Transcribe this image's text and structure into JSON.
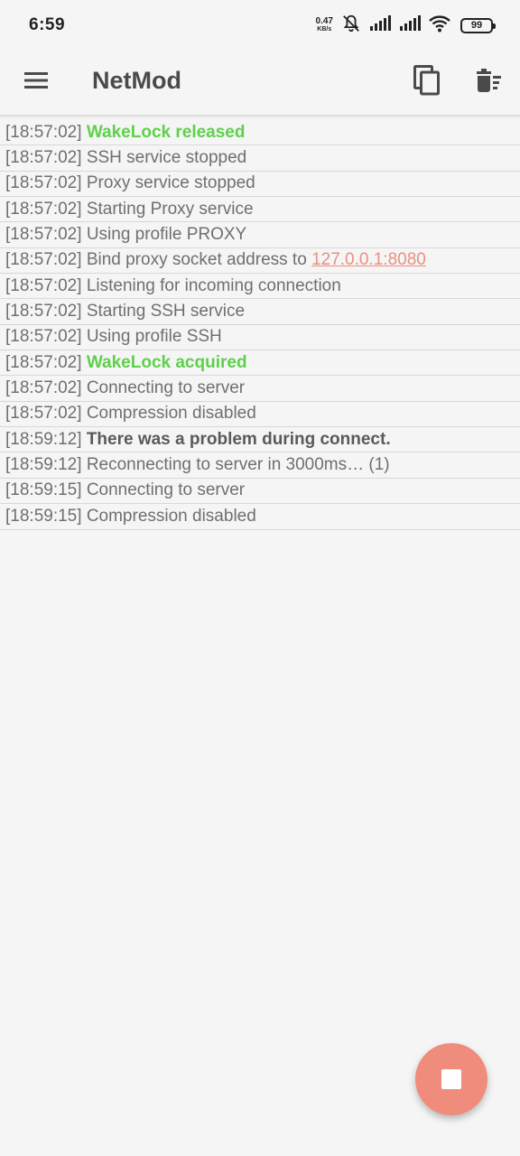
{
  "status_bar": {
    "time": "6:59",
    "net_speed_value": "0.47",
    "net_speed_unit": "KB/s",
    "battery": "99"
  },
  "app_bar": {
    "title": "NetMod",
    "menu_icon": "hamburger-menu-icon",
    "copy_icon": "copy-icon",
    "delete_icon": "delete-sweep-icon"
  },
  "log": [
    {
      "time": "[18:57:02]",
      "msg": "WakeLock released",
      "style": "green"
    },
    {
      "time": "[18:57:02]",
      "msg": "SSH service stopped",
      "style": "normal"
    },
    {
      "time": "[18:57:02]",
      "msg": "Proxy service stopped",
      "style": "normal"
    },
    {
      "time": "[18:57:02]",
      "msg": "Starting Proxy service",
      "style": "normal"
    },
    {
      "time": "[18:57:02]",
      "msg": "Using profile PROXY",
      "style": "normal"
    },
    {
      "time": "[18:57:02]",
      "msg": "Bind proxy socket address to ",
      "link": "127.0.0.1:8080",
      "style": "normal"
    },
    {
      "time": "[18:57:02]",
      "msg": "Listening for incoming connection",
      "style": "normal"
    },
    {
      "time": "[18:57:02]",
      "msg": "Starting SSH service",
      "style": "normal"
    },
    {
      "time": "[18:57:02]",
      "msg": "Using profile SSH",
      "style": "normal"
    },
    {
      "time": "[18:57:02]",
      "msg": "WakeLock acquired",
      "style": "green"
    },
    {
      "time": "[18:57:02]",
      "msg": "Connecting to server",
      "style": "normal"
    },
    {
      "time": "[18:57:02]",
      "msg": "Compression disabled",
      "style": "normal"
    },
    {
      "time": "[18:59:12]",
      "msg": "There was a problem during connect.",
      "style": "bold"
    },
    {
      "time": "[18:59:12]",
      "msg": "Reconnecting to server in 3000ms… (1)",
      "style": "normal"
    },
    {
      "time": "[18:59:15]",
      "msg": "Connecting to server",
      "style": "normal"
    },
    {
      "time": "[18:59:15]",
      "msg": "Compression disabled",
      "style": "normal"
    }
  ],
  "fab": {
    "icon": "stop-icon"
  },
  "colors": {
    "accent": "#ef8c7c",
    "success": "#5fd04a",
    "link": "#ec8f80",
    "text": "#6f6f6f",
    "background": "#f5f5f5"
  }
}
